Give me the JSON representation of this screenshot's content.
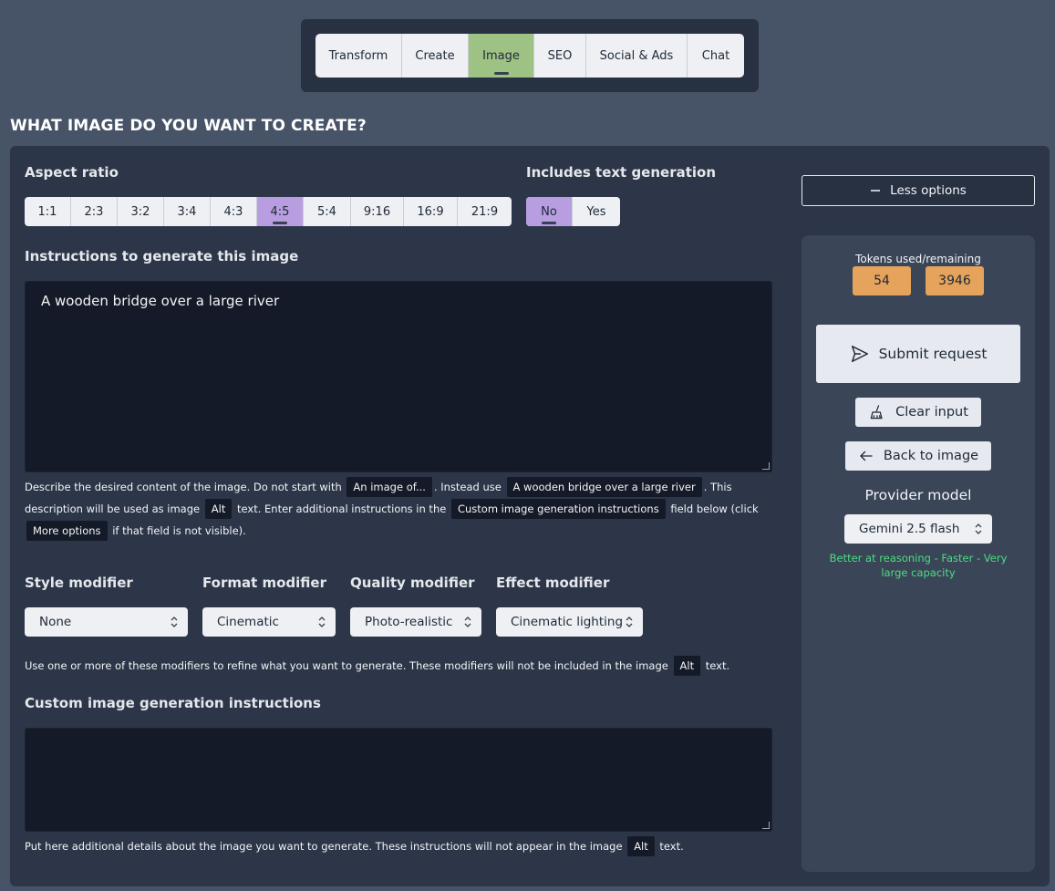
{
  "nav": {
    "tabs": [
      {
        "label": "Transform"
      },
      {
        "label": "Create"
      },
      {
        "label": "Image"
      },
      {
        "label": "SEO"
      },
      {
        "label": "Social & Ads"
      },
      {
        "label": "Chat"
      }
    ],
    "active": "Image"
  },
  "page": {
    "title": "WHAT IMAGE DO YOU WANT TO CREATE?"
  },
  "aspect": {
    "label": "Aspect ratio",
    "options": [
      "1:1",
      "2:3",
      "3:2",
      "3:4",
      "4:3",
      "4:5",
      "5:4",
      "9:16",
      "16:9",
      "21:9"
    ],
    "selected": "4:5"
  },
  "text_gen": {
    "label": "Includes text generation",
    "options": [
      "No",
      "Yes"
    ],
    "selected": "No"
  },
  "instructions": {
    "label": "Instructions to generate this image",
    "value": "A wooden bridge over a large river",
    "help": {
      "p1": "Describe the desired content of the image. Do not start with",
      "chip1": "An image of...",
      "p2": ". Instead use",
      "chip2": "A wooden bridge over a large river",
      "p3": ". This description will be used as image",
      "chip3": "Alt",
      "p4": "text. Enter additional instructions in the",
      "chip4": "Custom image generation instructions",
      "p5": "field below (click",
      "chip5": "More options",
      "p6": "if that field is not visible)."
    }
  },
  "modifiers": {
    "style": {
      "label": "Style modifier",
      "value": "None"
    },
    "format": {
      "label": "Format modifier",
      "value": "Cinematic"
    },
    "quality": {
      "label": "Quality modifier",
      "value": "Photo-realistic"
    },
    "effect": {
      "label": "Effect modifier",
      "value": "Cinematic lighting"
    },
    "help": {
      "p1": "Use one or more of these modifiers to refine what you want to generate. These modifiers will not be included in the image",
      "chip": "Alt",
      "p2": "text."
    }
  },
  "custom": {
    "label": "Custom image generation instructions",
    "value": "",
    "help": {
      "p1": "Put here additional details about the image you want to generate. These instructions will not appear in the image",
      "chip": "Alt",
      "p2": "text."
    }
  },
  "side": {
    "less_options": "Less options",
    "tokens_label": "Tokens used/remaining",
    "tokens_used": "54",
    "tokens_remaining": "3946",
    "submit": "Submit request",
    "clear": "Clear input",
    "back": "Back to image",
    "provider_label": "Provider model",
    "provider_value": "Gemini 2.5 flash",
    "provider_note": "Better at reasoning - Faster - Very large capacity"
  },
  "colors": {
    "background": "#475366",
    "panel": "#2c3648",
    "active_tab": "#9ec283",
    "active_option": "#b89ee0",
    "token_badge": "#e5a35b",
    "note_green": "#4ade80"
  }
}
